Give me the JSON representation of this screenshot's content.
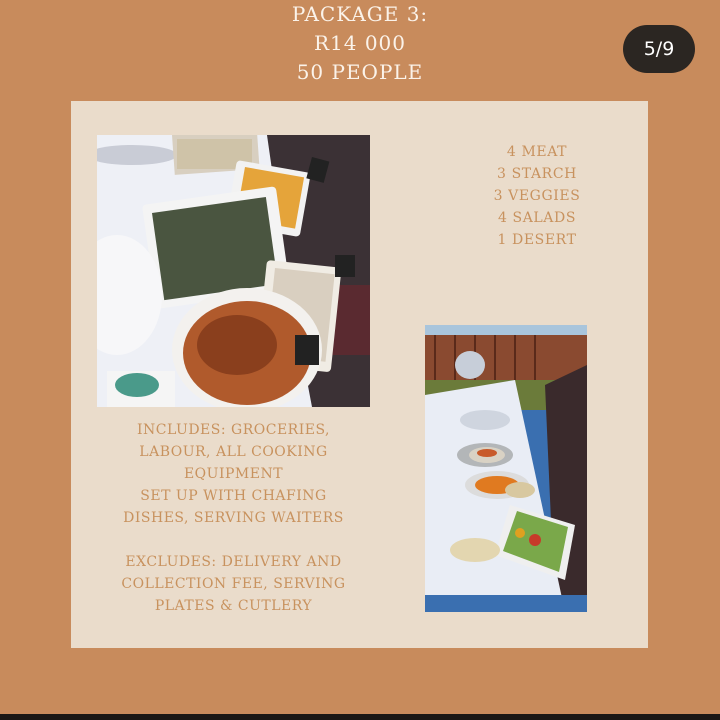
{
  "header": {
    "line1": "PACKAGE 3:",
    "line2": "R14 000",
    "line3": "50 PEOPLE"
  },
  "pager": {
    "label": "5/9"
  },
  "menu": {
    "items": [
      "4 MEAT",
      "3 STARCH",
      "3 VEGGIES",
      "4 SALADS",
      "1 DESERT"
    ]
  },
  "includes": {
    "lines": [
      "INCLUDES: GROCERIES,",
      "LABOUR, ALL COOKING",
      "EQUIPMENT",
      "SET UP WITH CHAFING",
      "DISHES, SERVING WAITERS"
    ]
  },
  "excludes": {
    "lines": [
      "EXCLUDES: DELIVERY AND",
      "COLLECTION FEE, SERVING",
      "PLATES & CUTLERY"
    ]
  },
  "colors": {
    "background": "#c88b5c",
    "card": "#eadccb",
    "accent_text": "#c8925e",
    "header_text": "#fbf3ea",
    "pager_bg": "#2b2622"
  }
}
